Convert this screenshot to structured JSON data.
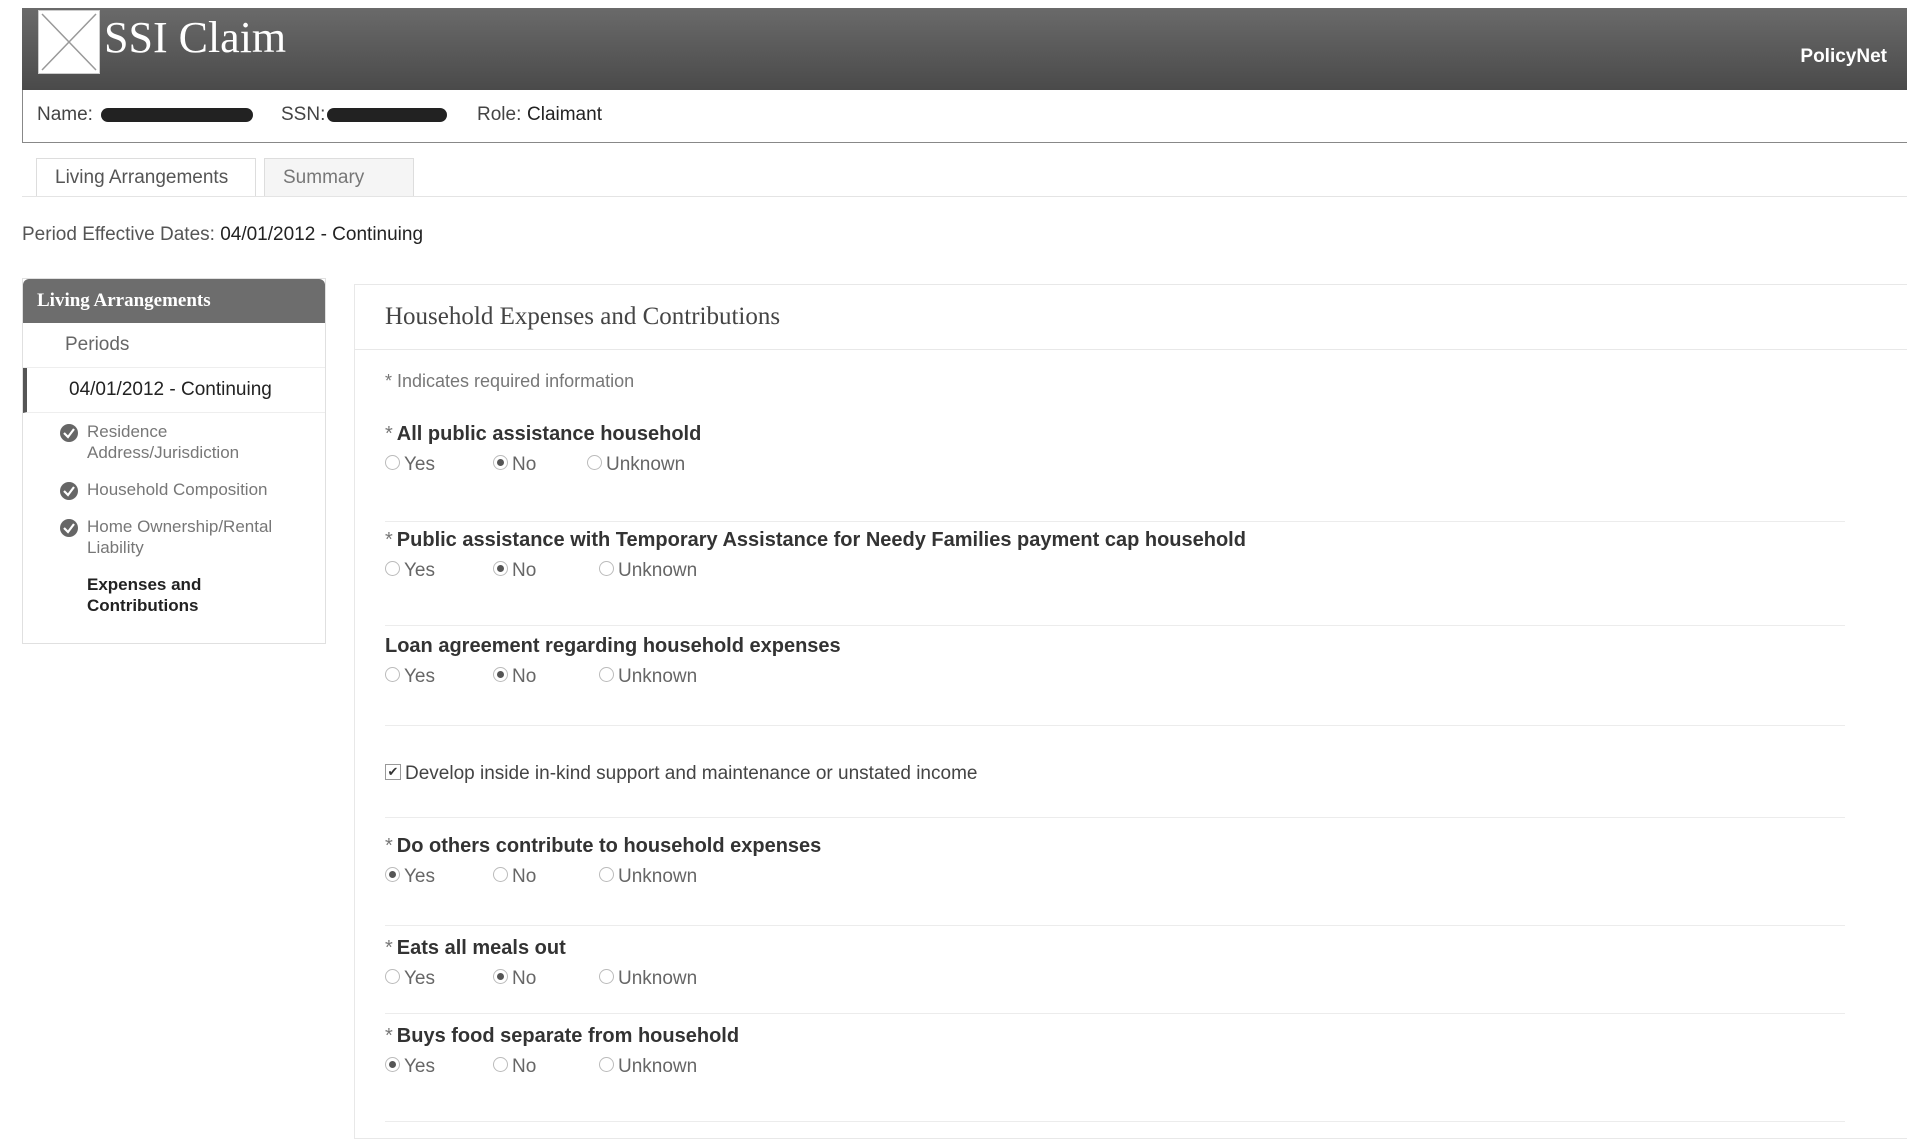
{
  "app": {
    "title": "SSI Claim",
    "brand": "PolicyNet"
  },
  "infobar": {
    "name_label": "Name:",
    "ssn_label": "SSN:",
    "role_label": "Role:",
    "role_value": "Claimant"
  },
  "tabs": [
    {
      "label": "Living Arrangements",
      "active": true
    },
    {
      "label": "Summary",
      "active": false
    }
  ],
  "period": {
    "label": "Period Effective Dates:",
    "value": "04/01/2012 - Continuing"
  },
  "sidebar": {
    "title": "Living Arrangements",
    "periods_label": "Periods",
    "active_period": "04/01/2012 - Continuing",
    "items": [
      {
        "line1": "Residence",
        "line2": "Address/Jurisdiction",
        "icon": "check-circle-icon",
        "completed": true
      },
      {
        "line1": "Household Composition",
        "line2": "",
        "icon": "check-circle-icon",
        "completed": true
      },
      {
        "line1": "Home Ownership/Rental",
        "line2": "Liability",
        "icon": "check-circle-icon",
        "completed": true
      },
      {
        "line1": "Expenses and",
        "line2": "Contributions",
        "completed": false,
        "current": true
      }
    ]
  },
  "panel": {
    "title": "Household Expenses and Contributions",
    "required_note": "* Indicates required information",
    "options": {
      "yes": "Yes",
      "no": "No",
      "unknown": "Unknown"
    },
    "questions": [
      {
        "required": true,
        "label": "All public assistance household",
        "selected": "No"
      },
      {
        "required": true,
        "label": "Public assistance with Temporary Assistance for Needy Families payment cap household",
        "selected": "No"
      },
      {
        "required": false,
        "label": "Loan agreement regarding household expenses",
        "selected": "No"
      },
      {
        "required": true,
        "label": "Do others contribute to household expenses",
        "selected": "Yes"
      },
      {
        "required": true,
        "label": "Eats all meals out",
        "selected": "No"
      },
      {
        "required": true,
        "label": "Buys food separate from household",
        "selected": "Yes"
      }
    ],
    "checkbox": {
      "label": "Develop inside in-kind support and maintenance or unstated income",
      "checked": true
    }
  }
}
